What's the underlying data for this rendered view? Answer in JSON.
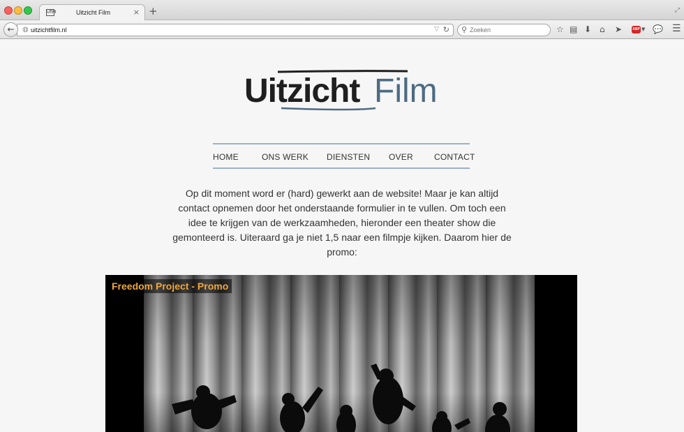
{
  "browser": {
    "tab_title": "Uitzicht Film",
    "tab_favicon_text": "UfiM",
    "tab_close": "×",
    "new_tab": "+",
    "url": "uitzichtfilm.nl",
    "search_placeholder": "Zoeken",
    "abp_label": "ABP",
    "icons": [
      "back-arrow-icon",
      "globe-icon",
      "reload-icon",
      "search-icon",
      "bookmark-star-icon",
      "reading-list-icon",
      "download-icon",
      "home-icon",
      "share-icon",
      "adblock-icon",
      "chat-icon",
      "menu-icon"
    ]
  },
  "site": {
    "logo": {
      "word1": "Uitzicht",
      "word2": "Film",
      "colors": {
        "primary": "#1f1f1f",
        "accent": "#4d6b83"
      }
    },
    "nav": [
      {
        "label": "HOME"
      },
      {
        "label": "ONS WERK"
      },
      {
        "label": "DIENSTEN"
      },
      {
        "label": "OVER"
      },
      {
        "label": "CONTACT"
      }
    ],
    "intro_text": "Op dit moment word er (hard) gewerkt aan de website! Maar je kan altijd contact opnemen door het onderstaande formulier in te vullen. Om toch een idee te krijgen van de werkzaamheden, hieronder een theater show die gemonteerd is. Uiteraard ga je niet 1,5 naar een filmpje kijken. Daarom hier de promo:",
    "video": {
      "title": "Freedom Project - Promo",
      "title_color": "#f0a73a"
    }
  }
}
